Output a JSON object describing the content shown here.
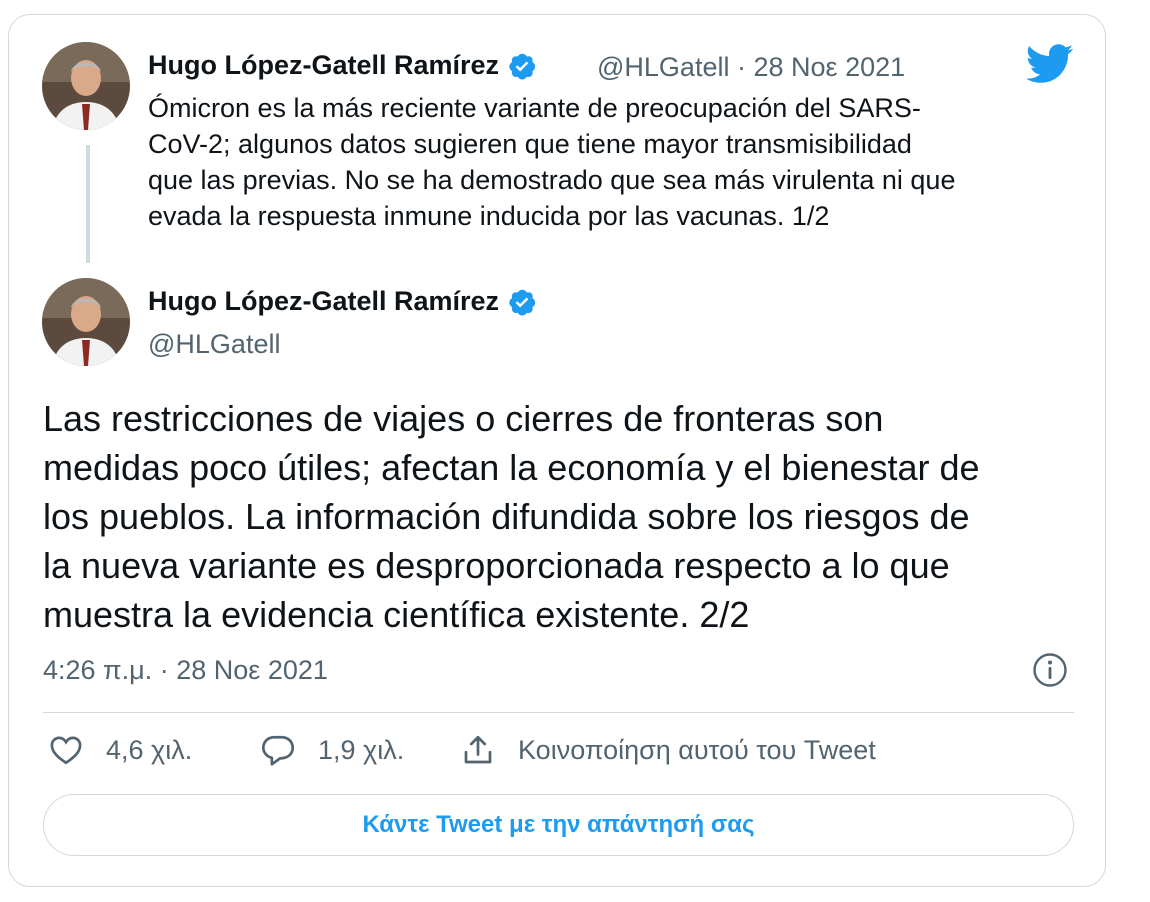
{
  "quoted_tweet": {
    "author_name": "Hugo López-Gatell Ramírez",
    "handle": "@HLGatell",
    "separator": "·",
    "date": "28 Νοε 2021",
    "text": "Ómicron es la más reciente variante de preocupación del SARS-\nCoV-2; algunos datos sugieren que tiene mayor transmisibilidad\nque las previas. No se ha demostrado que sea más virulenta ni que\nevada la respuesta inmune inducida por las vacunas. 1/2"
  },
  "main_tweet": {
    "author_name": "Hugo López-Gatell Ramírez",
    "handle": "@HLGatell",
    "text": "Las restricciones de viajes o cierres de fronteras son\nmedidas poco útiles; afectan la economía y el bienestar de\nlos pueblos. La información difundida sobre los riesgos de\nla nueva variante es desproporcionada respecto a lo que\nmuestra la evidencia científica existente. 2/2",
    "timestamp": "4:26 π.μ. · 28 Νοε 2021"
  },
  "actions": {
    "like_count": "4,6 χιλ.",
    "reply_count": "1,9 χιλ.",
    "share_label": "Κοινοποίηση αυτού του Tweet"
  },
  "reply_button_label": "Κάντε Tweet με την απάντησή σας",
  "icons": {
    "brand": "twitter-bird-icon",
    "verified": "verified-badge-icon",
    "info": "info-icon",
    "like": "heart-icon",
    "reply": "reply-bubble-icon",
    "share": "share-icon"
  },
  "colors": {
    "brand_blue": "#1d9bf0",
    "text": "#0f1419",
    "secondary_text": "#536471",
    "border": "#cfd9de"
  }
}
